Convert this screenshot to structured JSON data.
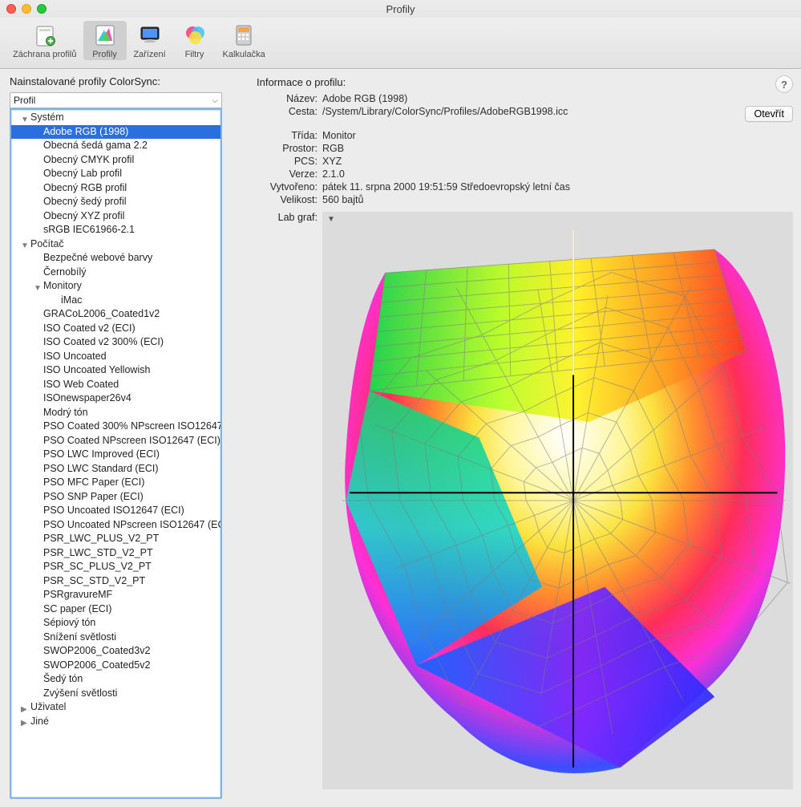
{
  "window": {
    "title": "Profily"
  },
  "toolbar": {
    "items": [
      {
        "key": "rescue",
        "label": "Záchrana profilů",
        "icon": "rescue-icon"
      },
      {
        "key": "profiles",
        "label": "Profily",
        "icon": "profiles-icon",
        "selected": true
      },
      {
        "key": "devices",
        "label": "Zařízení",
        "icon": "devices-icon"
      },
      {
        "key": "filters",
        "label": "Filtry",
        "icon": "filters-icon"
      },
      {
        "key": "calc",
        "label": "Kalkulačka",
        "icon": "calculator-icon"
      }
    ]
  },
  "left": {
    "heading": "Nainstalované profily ColorSync:",
    "select_value": "Profil",
    "tree": {
      "system_label": "Systém",
      "computer_label": "Počítač",
      "monitors_label": "Monitory",
      "user_label": "Uživatel",
      "other_label": "Jiné",
      "system_items": [
        {
          "label": "Adobe RGB (1998)",
          "selected": true
        },
        {
          "label": "Obecná šedá gama 2.2"
        },
        {
          "label": "Obecný CMYK profil"
        },
        {
          "label": "Obecný Lab profil"
        },
        {
          "label": "Obecný RGB profil"
        },
        {
          "label": "Obecný šedý profil"
        },
        {
          "label": "Obecný XYZ profil"
        },
        {
          "label": "sRGB IEC61966-2.1"
        }
      ],
      "computer_items_top": [
        {
          "label": "Bezpečné webové barvy"
        },
        {
          "label": "Černobílý"
        }
      ],
      "monitors_items": [
        {
          "label": "iMac"
        }
      ],
      "computer_items_rest": [
        {
          "label": "GRACoL2006_Coated1v2"
        },
        {
          "label": "ISO Coated v2 (ECI)"
        },
        {
          "label": "ISO Coated v2 300% (ECI)"
        },
        {
          "label": "ISO Uncoated"
        },
        {
          "label": "ISO Uncoated Yellowish"
        },
        {
          "label": "ISO Web Coated"
        },
        {
          "label": "ISOnewspaper26v4"
        },
        {
          "label": "Modrý tón"
        },
        {
          "label": "PSO Coated 300% NPscreen ISO12647",
          "dot": true
        },
        {
          "label": "PSO Coated NPscreen ISO12647 (ECI)"
        },
        {
          "label": "PSO LWC Improved (ECI)"
        },
        {
          "label": "PSO LWC Standard (ECI)"
        },
        {
          "label": "PSO MFC Paper (ECI)"
        },
        {
          "label": "PSO SNP Paper (ECI)"
        },
        {
          "label": "PSO Uncoated ISO12647 (ECI)"
        },
        {
          "label": "PSO Uncoated NPscreen ISO12647 (EC",
          "dot": true
        },
        {
          "label": "PSR_LWC_PLUS_V2_PT"
        },
        {
          "label": "PSR_LWC_STD_V2_PT"
        },
        {
          "label": "PSR_SC_PLUS_V2_PT"
        },
        {
          "label": "PSR_SC_STD_V2_PT"
        },
        {
          "label": "PSRgravureMF"
        },
        {
          "label": "SC paper (ECI)"
        },
        {
          "label": "Sépiový tón"
        },
        {
          "label": "Snížení světlosti"
        },
        {
          "label": "SWOP2006_Coated3v2"
        },
        {
          "label": "SWOP2006_Coated5v2"
        },
        {
          "label": "Šedý tón"
        },
        {
          "label": "Zvýšení světlosti"
        }
      ]
    }
  },
  "right": {
    "heading": "Informace o profilu:",
    "open_button": "Otevřít",
    "help_tooltip": "?",
    "fields": {
      "name_k": "Název:",
      "name_v": "Adobe RGB (1998)",
      "path_k": "Cesta:",
      "path_v": "/System/Library/ColorSync/Profiles/AdobeRGB1998.icc",
      "class_k": "Třída:",
      "class_v": "Monitor",
      "space_k": "Prostor:",
      "space_v": "RGB",
      "pcs_k": "PCS:",
      "pcs_v": "XYZ",
      "ver_k": "Verze:",
      "ver_v": "2.1.0",
      "created_k": "Vytvořeno:",
      "created_v": "pátek 11. srpna 2000 19:51:59 Středoevropský letní čas",
      "size_k": "Velikost:",
      "size_v": "560 bajtů",
      "labgraph_k": "Lab graf:"
    }
  }
}
